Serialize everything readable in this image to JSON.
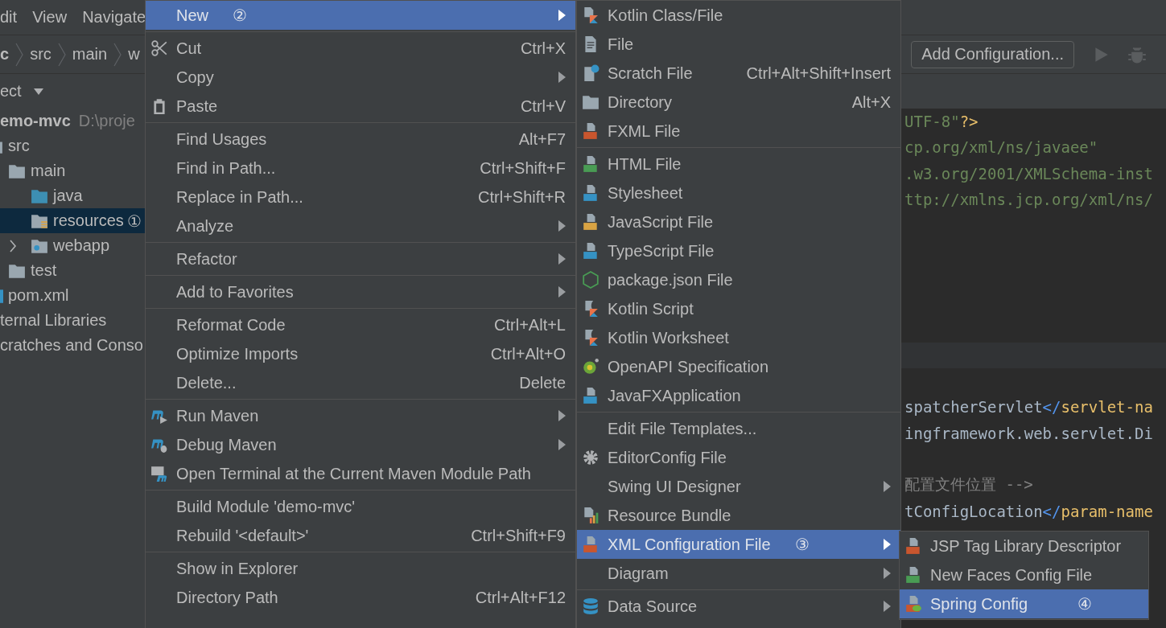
{
  "menu_bar": [
    "dit",
    "View",
    "Navigate"
  ],
  "breadcrumb": [
    {
      "label": "c",
      "bold": true
    },
    {
      "label": "src",
      "bold": false
    },
    {
      "label": "main",
      "bold": false
    },
    {
      "label": "w",
      "bold": false
    }
  ],
  "toolbar": {
    "run_configuration": "Add Configuration..."
  },
  "project_panel": {
    "title": "ect",
    "tree": [
      {
        "kind": "module",
        "label": "emo-mvc",
        "path": "D:\\proje",
        "selected": false,
        "children": [
          {
            "kind": "folder",
            "label": "src",
            "selected": false,
            "children": [
              {
                "kind": "folder",
                "label": "main",
                "selected": false,
                "children": [
                  {
                    "kind": "source-folder",
                    "label": "java",
                    "selected": false
                  },
                  {
                    "kind": "resource-folder",
                    "label": "resources",
                    "badge": "①",
                    "selected": true
                  },
                  {
                    "kind": "web-folder",
                    "label": "webapp",
                    "expanded": false,
                    "selected": false
                  }
                ]
              },
              {
                "kind": "folder",
                "label": "test",
                "selected": false
              }
            ]
          },
          {
            "kind": "maven-file",
            "label": "pom.xml",
            "selected": false
          }
        ]
      },
      {
        "kind": "plain",
        "label": "ternal Libraries",
        "selected": false
      },
      {
        "kind": "plain",
        "label": "cratches and Conso",
        "selected": false
      }
    ]
  },
  "editor": {
    "lines": [
      {
        "segments": [
          {
            "kind": "string",
            "text": "UTF-8\""
          },
          {
            "kind": "punct",
            "text": "?>"
          }
        ]
      },
      {
        "segments": [
          {
            "kind": "string",
            "text": "cp.org/xml/ns/javaee\""
          }
        ]
      },
      {
        "segments": [
          {
            "kind": "string",
            "text": ".w3.org/2001/XMLSchema-inst"
          }
        ]
      },
      {
        "segments": [
          {
            "kind": "string",
            "text": "ttp://xmlns.jcp.org/xml/ns/"
          }
        ]
      },
      {
        "segments": [
          {
            "kind": "text",
            "text": "spatcherServlet"
          },
          {
            "kind": "bracket",
            "text": "</"
          },
          {
            "kind": "tag",
            "text": "servlet-na"
          }
        ]
      },
      {
        "segments": [
          {
            "kind": "text",
            "text": "ingframework.web.servlet.Di"
          }
        ]
      },
      {
        "segments": [
          {
            "kind": "comment",
            "text": "配置文件位置 -->"
          }
        ]
      },
      {
        "segments": [
          {
            "kind": "text",
            "text": "tConfigLocation"
          },
          {
            "kind": "bracket",
            "text": "</"
          },
          {
            "kind": "tag",
            "text": "param-name"
          }
        ]
      }
    ]
  },
  "context_menu": {
    "groups": [
      [
        {
          "kind": "plain",
          "label": "New",
          "badge": "②",
          "submenu": true,
          "selected": true
        }
      ],
      [
        {
          "kind": "cut",
          "label": "Cut",
          "shortcut": "Ctrl+X",
          "submenu": false,
          "selected": false
        },
        {
          "kind": "plain",
          "label": "Copy",
          "submenu": true,
          "selected": false
        },
        {
          "kind": "paste",
          "label": "Paste",
          "shortcut": "Ctrl+V",
          "submenu": false,
          "selected": false
        }
      ],
      [
        {
          "kind": "plain",
          "label": "Find Usages",
          "shortcut": "Alt+F7",
          "submenu": false,
          "selected": false
        },
        {
          "kind": "plain",
          "label": "Find in Path...",
          "shortcut": "Ctrl+Shift+F",
          "submenu": false,
          "selected": false
        },
        {
          "kind": "plain",
          "label": "Replace in Path...",
          "shortcut": "Ctrl+Shift+R",
          "submenu": false,
          "selected": false
        },
        {
          "kind": "plain",
          "label": "Analyze",
          "submenu": true,
          "selected": false
        }
      ],
      [
        {
          "kind": "plain",
          "label": "Refactor",
          "submenu": true,
          "selected": false
        }
      ],
      [
        {
          "kind": "plain",
          "label": "Add to Favorites",
          "submenu": true,
          "selected": false
        }
      ],
      [
        {
          "kind": "plain",
          "label": "Reformat Code",
          "shortcut": "Ctrl+Alt+L",
          "submenu": false,
          "selected": false
        },
        {
          "kind": "plain",
          "label": "Optimize Imports",
          "shortcut": "Ctrl+Alt+O",
          "submenu": false,
          "selected": false
        },
        {
          "kind": "plain",
          "label": "Delete...",
          "shortcut": "Delete",
          "submenu": false,
          "selected": false
        }
      ],
      [
        {
          "kind": "run-maven",
          "label": "Run Maven",
          "submenu": true,
          "selected": false
        },
        {
          "kind": "debug-maven",
          "label": "Debug Maven",
          "submenu": true,
          "selected": false
        },
        {
          "kind": "terminal-maven",
          "label": "Open Terminal at the Current Maven Module Path",
          "submenu": false,
          "selected": false
        }
      ],
      [
        {
          "kind": "plain",
          "label": "Build Module 'demo-mvc'",
          "submenu": false,
          "selected": false
        },
        {
          "kind": "plain",
          "label": "Rebuild '<default>'",
          "shortcut": "Ctrl+Shift+F9",
          "submenu": false,
          "selected": false
        }
      ],
      [
        {
          "kind": "plain",
          "label": "Show in Explorer",
          "submenu": false,
          "selected": false
        },
        {
          "kind": "plain",
          "label": "Directory Path",
          "shortcut": "Ctrl+Alt+F12",
          "submenu": false,
          "selected": false
        }
      ]
    ]
  },
  "new_submenu": {
    "groups": [
      [
        {
          "kind": "kotlin",
          "label": "Kotlin Class/File",
          "submenu": false,
          "selected": false
        },
        {
          "kind": "file",
          "label": "File",
          "submenu": false,
          "selected": false
        },
        {
          "kind": "scratch",
          "label": "Scratch File",
          "shortcut": "Ctrl+Alt+Shift+Insert",
          "submenu": false,
          "selected": false
        },
        {
          "kind": "folder",
          "label": "Directory",
          "shortcut": "Alt+X",
          "submenu": false,
          "selected": false
        },
        {
          "kind": "fxml",
          "label": "FXML File",
          "submenu": false,
          "selected": false
        }
      ],
      [
        {
          "kind": "html",
          "label": "HTML File",
          "submenu": false,
          "selected": false
        },
        {
          "kind": "css",
          "label": "Stylesheet",
          "submenu": false,
          "selected": false
        },
        {
          "kind": "js",
          "label": "JavaScript File",
          "submenu": false,
          "selected": false
        },
        {
          "kind": "ts",
          "label": "TypeScript File",
          "submenu": false,
          "selected": false
        },
        {
          "kind": "package",
          "label": "package.json File",
          "submenu": false,
          "selected": false
        },
        {
          "kind": "kotlin-script",
          "label": "Kotlin Script",
          "submenu": false,
          "selected": false
        },
        {
          "kind": "kotlin-script",
          "label": "Kotlin Worksheet",
          "submenu": false,
          "selected": false
        },
        {
          "kind": "openapi",
          "label": "OpenAPI Specification",
          "submenu": false,
          "selected": false
        },
        {
          "kind": "javafx",
          "label": "JavaFXApplication",
          "submenu": false,
          "selected": false
        }
      ],
      [
        {
          "kind": "plain",
          "label": "Edit File Templates...",
          "submenu": false,
          "selected": false
        },
        {
          "kind": "gear",
          "label": "EditorConfig File",
          "submenu": false,
          "selected": false
        },
        {
          "kind": "plain",
          "label": "Swing UI Designer",
          "submenu": true,
          "selected": false
        },
        {
          "kind": "bundle",
          "label": "Resource Bundle",
          "submenu": false,
          "selected": false
        },
        {
          "kind": "xml",
          "label": "XML Configuration File",
          "badge": "③",
          "submenu": true,
          "selected": true
        },
        {
          "kind": "plain",
          "label": "Diagram",
          "submenu": true,
          "selected": false
        }
      ],
      [
        {
          "kind": "database",
          "label": "Data Source",
          "submenu": true,
          "selected": false
        }
      ]
    ]
  },
  "xml_submenu": {
    "groups": [
      [
        {
          "kind": "xml",
          "label": "JSP Tag Library Descriptor",
          "submenu": false,
          "selected": false
        },
        {
          "kind": "jsf",
          "label": "New Faces Config File",
          "submenu": false,
          "selected": false
        },
        {
          "kind": "spring",
          "label": "Spring Config",
          "badge": "④",
          "submenu": false,
          "selected": true
        }
      ]
    ]
  }
}
